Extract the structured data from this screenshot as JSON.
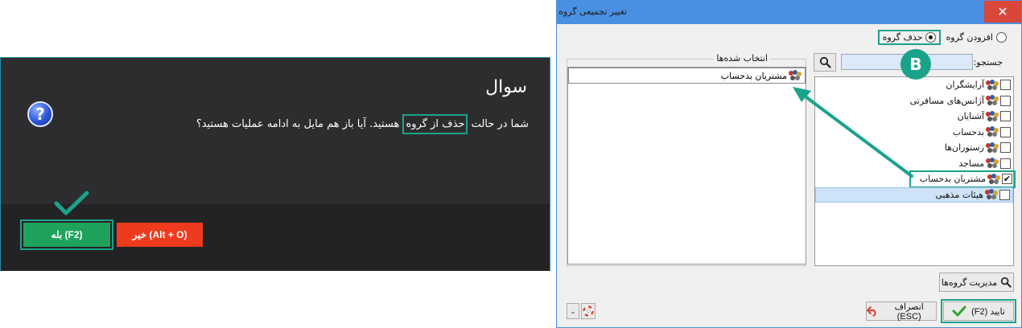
{
  "question_dialog": {
    "title": "سوال",
    "message_before": "شما در حالت ",
    "message_highlight": "حذف از گروه",
    "message_after": " هستید. آیا باز هم مایل به ادامه عملیات هستید؟",
    "yes_label": "(F2) بله",
    "no_label": "(Alt + O) خیر",
    "question_icon_glyph": "?"
  },
  "group_dialog": {
    "title": "تغییر تجمیعی گروه",
    "close_glyph": "✕",
    "modes": [
      {
        "label": "افزودن گروه",
        "selected": false
      },
      {
        "label": "حذف گروه",
        "selected": true
      }
    ],
    "search_label": "جستجو:",
    "search_value": "",
    "selected_legend": "انتخاب شده‌ها",
    "selected_items": [
      "مشتریان بدحساب"
    ],
    "groups": [
      {
        "label": "آرایشگران",
        "checked": false
      },
      {
        "label": "آژانس‌های مسافرتی",
        "checked": false
      },
      {
        "label": "آشنایان",
        "checked": false
      },
      {
        "label": "بدحساب",
        "checked": false
      },
      {
        "label": "رستوران‌ها",
        "checked": false
      },
      {
        "label": "مساجد",
        "checked": false
      },
      {
        "label": "مشتریان بدحساب",
        "checked": true
      },
      {
        "label": "هیئات مذهبی",
        "checked": false
      }
    ],
    "manage_label": "مدیریت گروه‌ها",
    "ok_label": "تایید (F2)",
    "cancel_label": "انصراف (ESC)",
    "dropdown_glyph": "⌄"
  },
  "annotation": {
    "marker_letter": "B",
    "accent_color": "#1aa38a"
  }
}
